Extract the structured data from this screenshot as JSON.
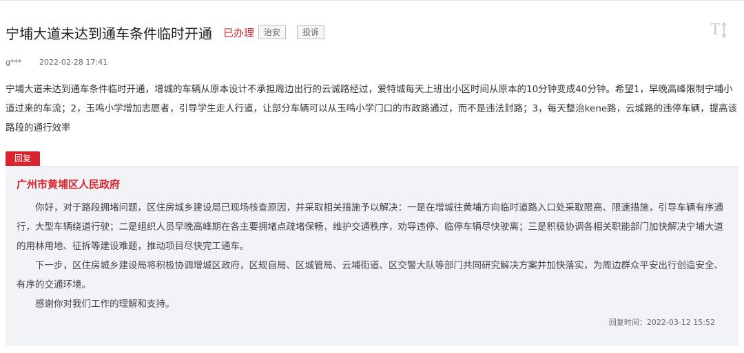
{
  "case": {
    "title": "宁埔大道未达到通车条件临时开通",
    "status": "已办理",
    "category_tag": "治安",
    "type_tag": "投诉",
    "author": "g***",
    "date": "2022-02-28 17:41",
    "content": "宁埔大道未达到通车条件临时开通，增城的车辆从原本设计不承担周边出行的云诚路经过，爱特城每天上班出小区时间从原本的10分钟变成40分钟。希望1，早晚高峰限制宁埔小道过来的车流；2，玉鸣小学增加志愿者，引导学生走人行道，让部分车辆可以从玉鸣小学门口的市政路通过，而不是违法封路；3，每天整治kene路，云城路的违停车辆，提高该路段的通行效率"
  },
  "reply": {
    "badge": "回复",
    "department": "广州市黄埔区人民政府",
    "paragraphs": [
      "你好，对于路段拥堵问题，区住房城乡建设局已现场核查原因，并采取相关措施予以解决：一是在增城往黄埔方向临时道路入口处采取限高、限速措施，引导车辆有序通行，大型车辆绕道行驶；二是组织人员早晚高峰期在各主要拥堵点疏堵保畅，维护交通秩序，劝导违停、临停车辆尽快驶离；三是积极协调各相关职能部门加快解决宁埔大道的用林用地、征拆等建设难题，推动项目尽快完工通车。",
      "下一步，区住房城乡建设局将积极协调增城区政府，区规自局、区城管局、云埔街道、区交警大队等部门共同研究解决方案并加快落实，为周边群众平安出行创造安全、有序的交通环境。",
      "感谢你对我们工作的理解和支持。"
    ],
    "time": "回复时间：2022-03-12 15:52"
  },
  "icons": {
    "font_size": "font-size-icon"
  },
  "colors": {
    "accent_red": "#d9232d",
    "reply_background": "#f2f3f7"
  }
}
